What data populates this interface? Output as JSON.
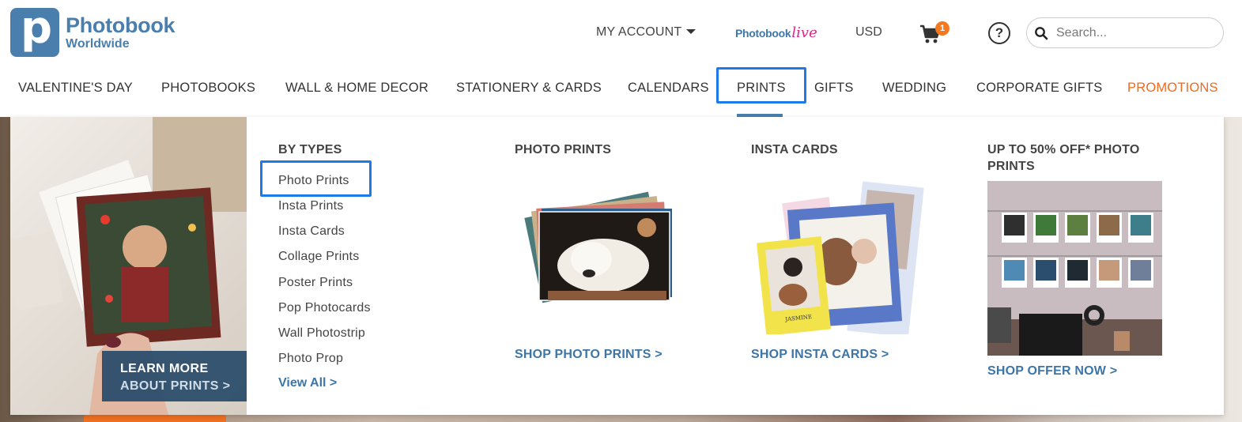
{
  "brand": {
    "title": "Photobook",
    "subtitle": "Worldwide",
    "mark_letter": "p"
  },
  "header": {
    "account_label": "MY ACCOUNT",
    "photobook_live_a": "Photobook",
    "photobook_live_b": "live",
    "currency": "USD",
    "cart_count": "1",
    "help_symbol": "?",
    "search_placeholder": "Search..."
  },
  "nav": {
    "items": [
      "VALENTINE'S DAY",
      "PHOTOBOOKS",
      "WALL & HOME DECOR",
      "STATIONERY & CARDS",
      "CALENDARS",
      "PRINTS",
      "GIFTS",
      "WEDDING",
      "CORPORATE GIFTS",
      "PROMOTIONS"
    ],
    "active": "PRINTS"
  },
  "mega_menu": {
    "promo": {
      "line1": "LEARN MORE",
      "line2": "ABOUT PRINTS >"
    },
    "by_types": {
      "heading": "BY TYPES",
      "links": [
        "Photo Prints",
        "Insta Prints",
        "Insta Cards",
        "Collage Prints",
        "Poster Prints",
        "Pop Photocards",
        "Wall Photostrip",
        "Photo Prop"
      ],
      "view_all": "View All >"
    },
    "photo_prints": {
      "heading": "PHOTO PRINTS",
      "cta": "SHOP PHOTO PRINTS >"
    },
    "insta_cards": {
      "heading": "INSTA CARDS",
      "cta": "SHOP INSTA CARDS >",
      "card_name": "JASMINE"
    },
    "offer": {
      "heading_line1": "UP TO 50% OFF* PHOTO",
      "heading_line2": "PRINTS",
      "cta": "SHOP OFFER NOW >"
    }
  },
  "colors": {
    "brand_blue": "#4a7fad",
    "link_blue": "#3d75a7",
    "promo_orange": "#f06a1d",
    "highlight_blue": "#1e7ae6",
    "cart_badge": "#f47820",
    "live_pink": "#e0258a"
  },
  "icons": [
    "logo-p-mark",
    "caret-down-icon",
    "cart-icon",
    "help-icon",
    "search-icon"
  ]
}
